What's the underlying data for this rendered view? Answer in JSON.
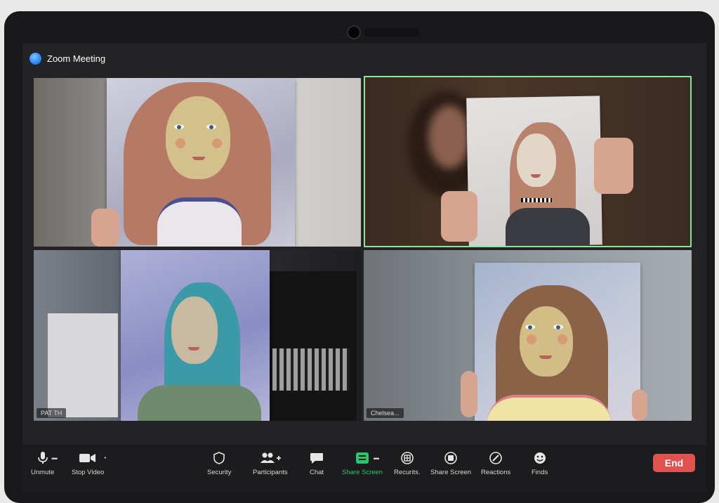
{
  "window": {
    "title": "Zoom Meeting"
  },
  "tiles": [
    {
      "name": ""
    },
    {
      "name": ""
    },
    {
      "name": "PAT TH"
    },
    {
      "name": "Chelsea..."
    }
  ],
  "toolbar": {
    "unmute": "Unmute",
    "stop_video": "Stop Video",
    "security": "Security",
    "participants": "Participants",
    "chat": "Chat",
    "share_screen": "Share Screen",
    "recurits": "Recurits.",
    "share_screen_2": "Share Screen",
    "reactions": "Reactions",
    "finds": "Finds",
    "end": "End"
  },
  "colors": {
    "active_speaker_border": "#8fe39a",
    "share_screen_green": "#2ac46a",
    "end_button": "#e0524d",
    "zoom_blue": "#2d8cff"
  },
  "icons": [
    "zoom-logo-icon",
    "microphone-icon",
    "video-camera-icon",
    "shield-icon",
    "participants-icon",
    "chat-icon",
    "share-screen-icon",
    "record-icon",
    "stop-icon",
    "reactions-icon",
    "apps-icon"
  ]
}
